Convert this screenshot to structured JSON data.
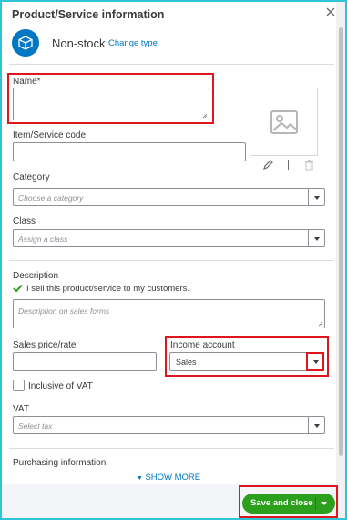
{
  "panel": {
    "title": "Product/Service information",
    "close_icon": "close-icon"
  },
  "type": {
    "icon": "box-icon",
    "label": "Non-stock",
    "change_link": "Change type"
  },
  "fields": {
    "name": {
      "label": "Name*",
      "value": ""
    },
    "item_code": {
      "label": "Item/Service code",
      "value": ""
    },
    "category": {
      "label": "Category",
      "placeholder": "Choose a category"
    },
    "class": {
      "label": "Class",
      "placeholder": "Assign a class"
    },
    "description": {
      "label": "Description",
      "sell_checkbox_label": "I sell this product/service to my customers.",
      "sell_checked": true,
      "placeholder": "Description on sales forms"
    },
    "sales_price": {
      "label": "Sales price/rate",
      "value": ""
    },
    "income_account": {
      "label": "Income account",
      "value": "Sales"
    },
    "inclusive_vat": {
      "label": "Inclusive of VAT",
      "checked": false
    },
    "vat": {
      "label": "VAT",
      "placeholder": "Select tax"
    },
    "purchasing": {
      "label": "Purchasing information"
    }
  },
  "image": {
    "placeholder_icon": "image-placeholder-icon",
    "edit_icon": "pencil-icon",
    "delete_icon": "trash-icon"
  },
  "footer": {
    "show_more": "SHOW MORE",
    "save_label": "Save and close"
  },
  "colors": {
    "accent_blue": "#0077c5",
    "save_green": "#2ca01c",
    "highlight_red": "#e0161e",
    "frame_cyan": "#2ec4d6"
  }
}
